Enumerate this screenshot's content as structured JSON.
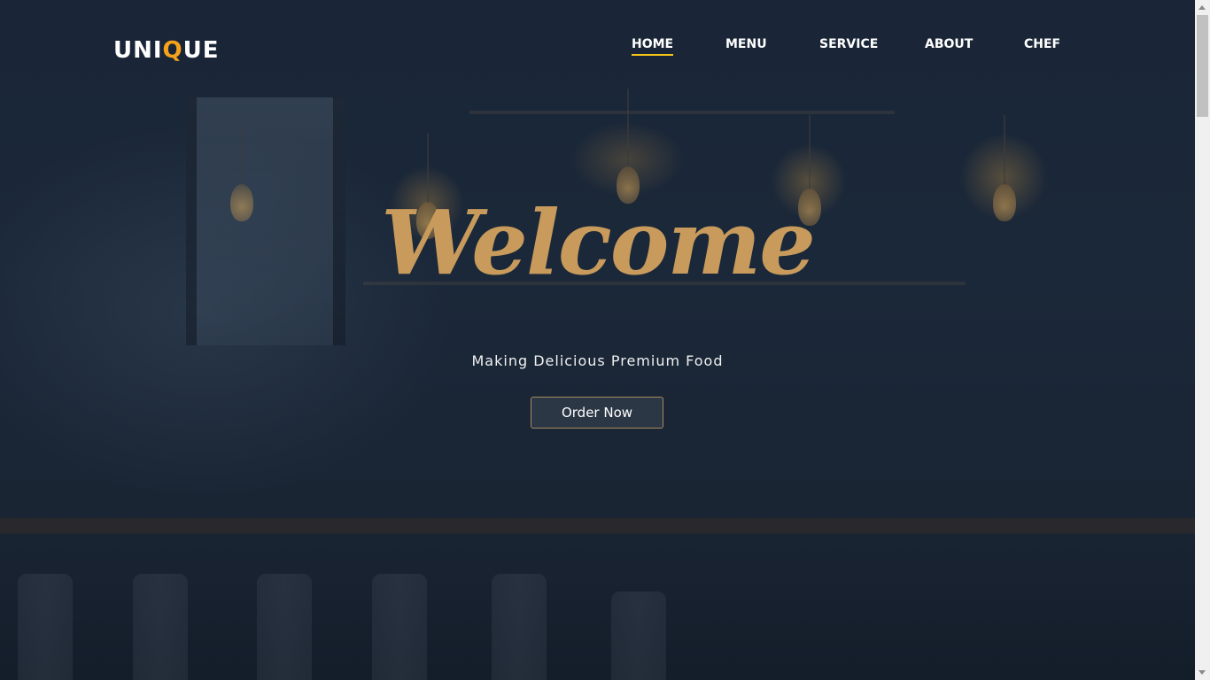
{
  "header": {
    "logo_prefix": "UNI",
    "logo_accent": "Q",
    "logo_suffix": "UE",
    "accent_color": "#f5a31a"
  },
  "nav": {
    "items": [
      {
        "label": "HOME",
        "active": true
      },
      {
        "label": "MENU",
        "active": false
      },
      {
        "label": "SERVICE",
        "active": false
      },
      {
        "label": "ABOUT",
        "active": false
      },
      {
        "label": "CHEF",
        "active": false
      }
    ],
    "active_underline_color": "#f5c518"
  },
  "hero": {
    "title": "Welcome",
    "title_color": "#c89b5c",
    "tagline": "Making Delicious Premium Food",
    "cta_label": "Order Now"
  }
}
